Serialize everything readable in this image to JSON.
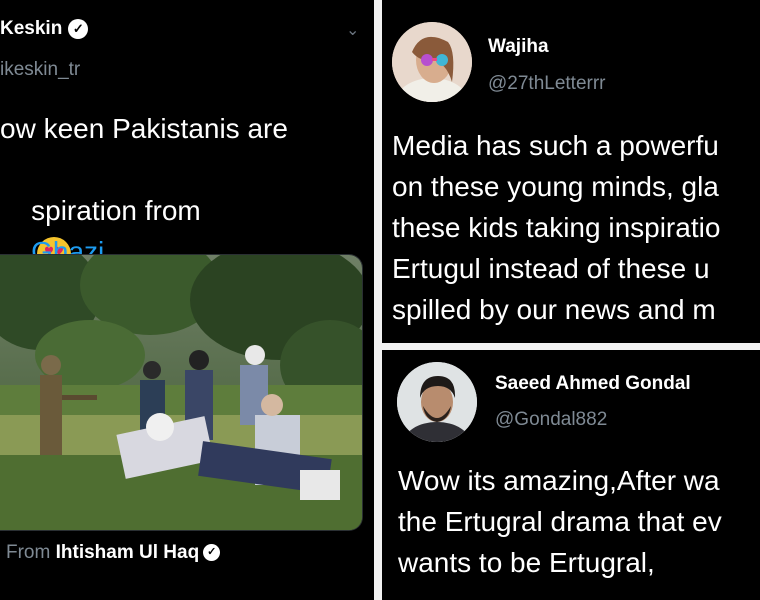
{
  "left_tweet": {
    "name": "Keskin",
    "handle": "ikeskin_tr",
    "text_line1": "ow keen Pakistanis are",
    "text_line2": "spiration from",
    "hashtag": "Ghazi",
    "from_label": "From",
    "from_name": "Ihtisham Ul Haq",
    "icons": [
      "verified-icon",
      "chevron-down-icon",
      "heart-eyes-emoji",
      "turkey-flag",
      "pakistan-flag"
    ]
  },
  "right_top_tweet": {
    "name": "Wajiha",
    "handle": "@27thLetterrr",
    "lines": [
      "Media has such a powerfu",
      "on these young minds, gla",
      "these kids taking inspiratio",
      "Ertugul instead of these u",
      "spilled by our news and m"
    ]
  },
  "right_bottom_tweet": {
    "name": "Saeed Ahmed Gondal",
    "handle": "@Gondal882",
    "lines": [
      "Wow its amazing,After wa",
      "the Ertugral drama that ev",
      "wants to be Ertugral,"
    ]
  },
  "colors": {
    "background": "#000000",
    "link": "#1d9bf0",
    "muted": "#7f8a94"
  }
}
